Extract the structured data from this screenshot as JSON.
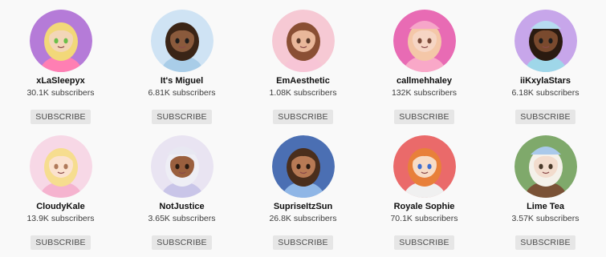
{
  "channels": [
    {
      "name": "xLaSleepyx",
      "subscribers": "30.1K subscribers",
      "button": "SUBSCRIBE",
      "bg": "#b57bd8",
      "skin": "#f3d6b8",
      "hair": "#f2d879",
      "shirt": "#ff7fb3",
      "eyes": "#6bbf4a",
      "hat": "",
      "avatar_icon": "girl-avatar-icon"
    },
    {
      "name": "It's Miguel",
      "subscribers": "6.81K subscribers",
      "button": "SUBSCRIBE",
      "bg": "#cfe3f4",
      "skin": "#8a5a3c",
      "hair": "#3a2416",
      "shirt": "#a9cde8",
      "eyes": "#1d1d1d",
      "hat": "",
      "avatar_icon": "boy-avatar-icon"
    },
    {
      "name": "EmAesthetic",
      "subscribers": "1.08K subscribers",
      "button": "SUBSCRIBE",
      "bg": "#f6c9d4",
      "skin": "#e9b79a",
      "hair": "#8a4f34",
      "shirt": "#f7c5d6",
      "eyes": "#5a3a2a",
      "hat": "",
      "avatar_icon": "girl-avatar-icon"
    },
    {
      "name": "callmehhaley",
      "subscribers": "132K subscribers",
      "button": "SUBSCRIBE",
      "bg": "#e86bb4",
      "skin": "#f6d5c4",
      "hair": "#f4c7a8",
      "shirt": "#f9a8c8",
      "eyes": "#7b4b3a",
      "hat": "#f6a6c9",
      "avatar_icon": "girl-avatar-icon"
    },
    {
      "name": "iiKxylaStars",
      "subscribers": "6.18K subscribers",
      "button": "SUBSCRIBE",
      "bg": "#c7a6ea",
      "skin": "#7a4a2e",
      "hair": "#2a1a10",
      "shirt": "#9fd7e9",
      "eyes": "#1d1d1d",
      "hat": "#b7dbf0",
      "avatar_icon": "girl-avatar-icon"
    },
    {
      "name": "CloudyKale",
      "subscribers": "13.9K subscribers",
      "button": "SUBSCRIBE",
      "bg": "#f7d8e6",
      "skin": "#fbe2cf",
      "hair": "#f6dd8f",
      "shirt": "#f5b3cf",
      "eyes": "#b07a5a",
      "hat": "",
      "avatar_icon": "girl-avatar-icon"
    },
    {
      "name": "NotJustice",
      "subscribers": "3.65K subscribers",
      "button": "SUBSCRIBE",
      "bg": "#e9e4f2",
      "skin": "#9a5f3e",
      "hair": "#eeeef5",
      "shirt": "#c9c5e8",
      "eyes": "#2a1a10",
      "hat": "#e8e8f2",
      "avatar_icon": "girl-avatar-icon"
    },
    {
      "name": "SupriseItzSun",
      "subscribers": "26.8K subscribers",
      "button": "SUBSCRIBE",
      "bg": "#4b6fb3",
      "skin": "#b77a55",
      "hair": "#4a2e1c",
      "shirt": "#8fb6e6",
      "eyes": "#2a1a10",
      "hat": "",
      "avatar_icon": "girl-avatar-icon"
    },
    {
      "name": "Royale Sophie",
      "subscribers": "70.1K subscribers",
      "button": "SUBSCRIBE",
      "bg": "#ea6a6a",
      "skin": "#f7dcc6",
      "hair": "#e8803a",
      "shirt": "#f0f0f0",
      "eyes": "#3f6fd1",
      "hat": "",
      "avatar_icon": "girl-avatar-icon"
    },
    {
      "name": "Lime Tea",
      "subscribers": "3.57K subscribers",
      "button": "SUBSCRIBE",
      "bg": "#7fa96b",
      "skin": "#f2dccd",
      "hair": "#f4f1ea",
      "shirt": "#7a5236",
      "eyes": "#4a3a2a",
      "hat": "#a9c9ea",
      "avatar_icon": "girl-avatar-icon"
    }
  ]
}
